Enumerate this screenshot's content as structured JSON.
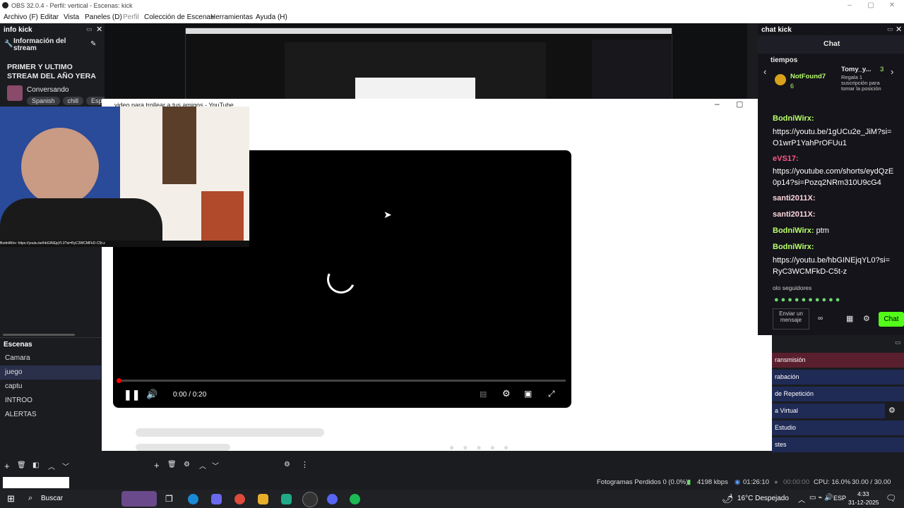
{
  "window": {
    "title": "OBS 32.0.4 - Perfil: vertical - Escenas: kick",
    "min": "–",
    "max": "▢",
    "close": "✕"
  },
  "menu": [
    "Archivo (F)",
    "Editar",
    "Vista",
    "Paneles (D)",
    "Perfil",
    "Colección de Escenas",
    "Herramientas",
    "Ayuda (H)"
  ],
  "info_dock": {
    "title": "info kick",
    "section": "Información del stream",
    "stream_title": "PRIMER Y ULTIMO STREAM DEL AÑO YERA",
    "category": "Conversando",
    "tags": [
      "Spanish",
      "chill",
      "Espa"
    ]
  },
  "scenes": {
    "title": "Escenas",
    "items": [
      "Camara",
      "juego",
      "captu",
      "INTROO",
      "ALERTAS"
    ],
    "selected": "juego"
  },
  "youtube": {
    "window_title": "video para trollear a tus amigos - YouTube",
    "time": "0:00 / 0:20"
  },
  "webcam_ticker": "BodniWirx: https://youtu.be/hbGINEjqYL0?si=RyC3WCMFkD-C5t-z",
  "chat_dock": {
    "title": "chat kick",
    "header": "Chat",
    "leaderboard_label": "tiempos",
    "top_user": "NotFound7",
    "top_count": "6",
    "gift_user": "Tomy_y...",
    "gift_count": "3",
    "gift_text": "Regala 1 suscripción para tomar la posición",
    "messages": [
      {
        "user": "BodniWirx:",
        "text": "https://youtu.be/1gUCu2e_JiM?si=O1wrP1YahPrOFUu1"
      },
      {
        "user": "eVS17:",
        "text": "https://youtube.com/shorts/eydQzE0p14?si=Pozq2NRm310U9cG4"
      },
      {
        "user": "santi2011X:",
        "text": ""
      },
      {
        "user": "santi2011X:",
        "text": ""
      },
      {
        "user": "BodniWirx:",
        "text": "ptm"
      },
      {
        "user": "BodniWirx:",
        "text": "https://youtu.be/hbGINEjqYL0?si=RyC3WCMFkD-C5t-z"
      }
    ],
    "followers_only": "olo seguidores",
    "send_placeholder": "Enviar un mensaje",
    "chat_button": "Chat"
  },
  "controls": [
    {
      "label": "ransmisión",
      "color": "#5a1f2e"
    },
    {
      "label": "rabación",
      "color": "#1f2a55"
    },
    {
      "label": " de Repetición",
      "color": "#1f2a55"
    },
    {
      "label": "a Virtual",
      "color": "#1f2a55"
    },
    {
      "label": "Estudio",
      "color": "#1f2a55"
    },
    {
      "label": "stes",
      "color": "#1f2a55"
    }
  ],
  "status": {
    "dropped": "Fotogramas Perdidos 0 (0.0%)",
    "bitrate": "4198 kbps",
    "stream_time": "01:26:10",
    "rec_time": "00:00:00",
    "cpu": "CPU: 16.0%",
    "fps": "30.00 / 30.00 FPS"
  },
  "taskbar": {
    "search": "Buscar",
    "weather": "16°C  Despejado",
    "lang": "ESP",
    "time": "4:33",
    "date": "31-12-2025"
  }
}
